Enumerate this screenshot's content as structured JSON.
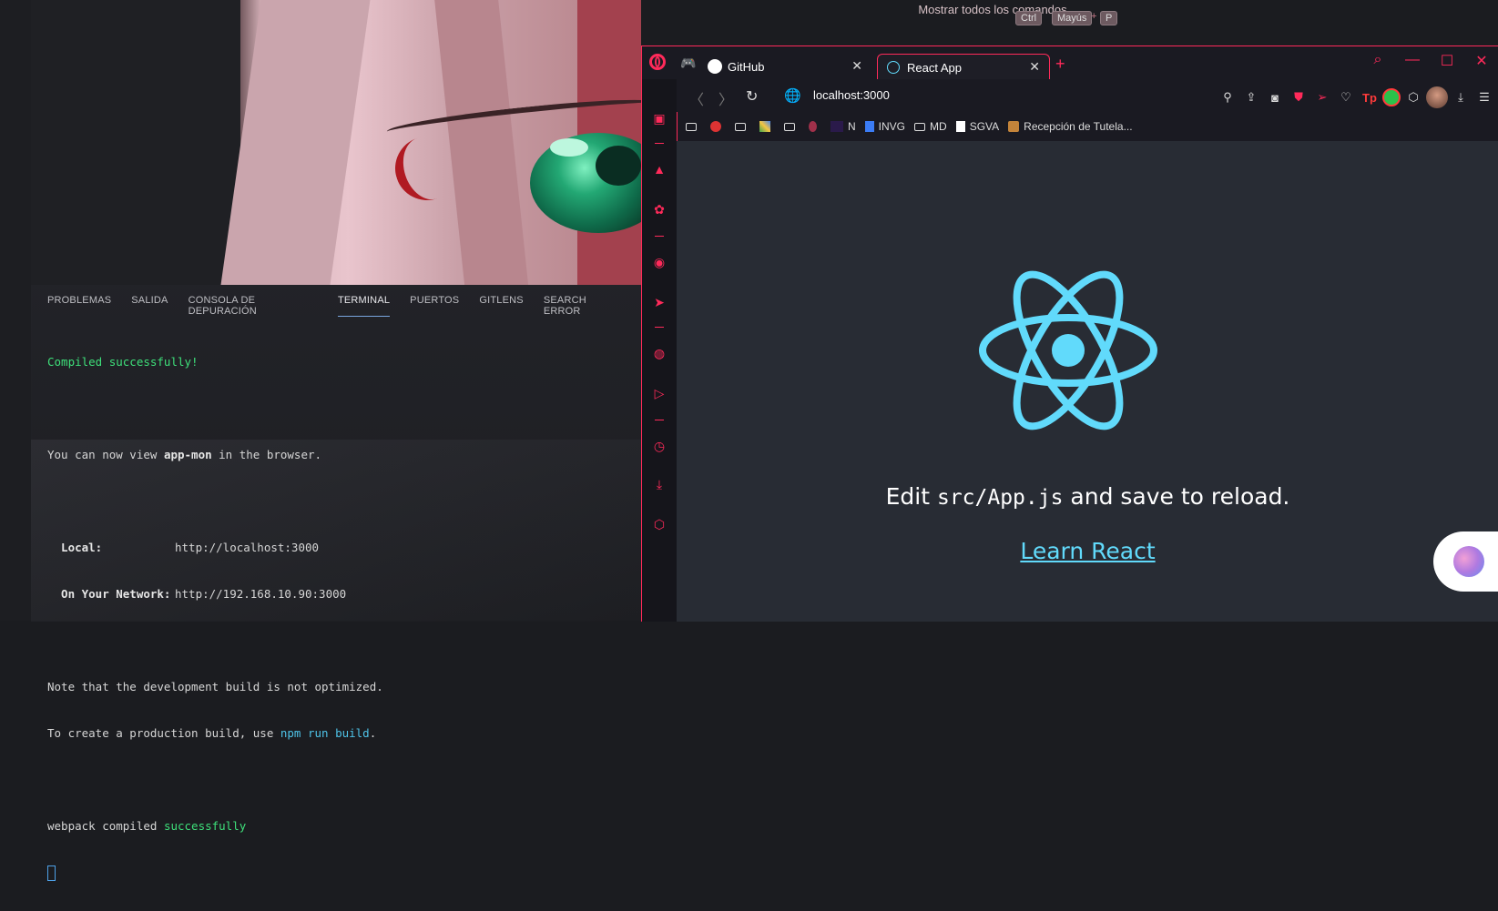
{
  "vscode": {
    "command_hint": "Mostrar todos los comandos",
    "command_keys": [
      "Ctrl",
      "Mayús",
      "+",
      "P"
    ],
    "panel_tabs": [
      "PROBLEMAS",
      "SALIDA",
      "CONSOLA DE DEPURACIÓN",
      "TERMINAL",
      "PUERTOS",
      "GITLENS",
      "SEARCH ERROR"
    ],
    "active_tab": "TERMINAL",
    "terminal": {
      "compiled": "Compiled successfully!",
      "view_prefix": "You can now view ",
      "app_name": "app-mon",
      "view_suffix": " in the browser.",
      "local_label": "  Local:",
      "local_url": "http://localhost:3000",
      "network_label": "  On Your Network:",
      "network_url": "http://192.168.10.90:3000",
      "note1": "Note that the development build is not optimized.",
      "note2_prefix": "To create a production build, use ",
      "note2_cmd": "npm run build",
      "note2_suffix": ".",
      "webpack_prefix": "webpack compiled ",
      "webpack_status": "successfully"
    }
  },
  "browser": {
    "tabs": [
      {
        "title": "GitHub",
        "icon": "github-icon"
      },
      {
        "title": "React App",
        "icon": "react-icon",
        "active": true
      }
    ],
    "address": "localhost:3000",
    "bookmarks": [
      {
        "label": "",
        "icon": "folder-icon"
      },
      {
        "label": "",
        "icon": "bot-icon"
      },
      {
        "label": "",
        "icon": "folder-icon"
      },
      {
        "label": "",
        "icon": "image-icon"
      },
      {
        "label": "",
        "icon": "folder-icon"
      },
      {
        "label": "",
        "icon": "hand-icon"
      },
      {
        "label": "N",
        "icon": "n-icon"
      },
      {
        "label": "INVG",
        "icon": "docs-icon"
      },
      {
        "label": "MD",
        "icon": "folder-icon"
      },
      {
        "label": "SGVA",
        "icon": "doc-icon"
      },
      {
        "label": "Recepción de Tutela...",
        "icon": "gallery-icon"
      }
    ],
    "page": {
      "edit_prefix": "Edit ",
      "edit_code": "src/App.js",
      "edit_suffix": " and save to reload.",
      "link": "Learn React"
    }
  },
  "colors": {
    "opera_accent": "#ff2a5a",
    "react_cyan": "#61dafb",
    "terminal_green": "#3ee07a",
    "page_bg": "#282c34"
  }
}
